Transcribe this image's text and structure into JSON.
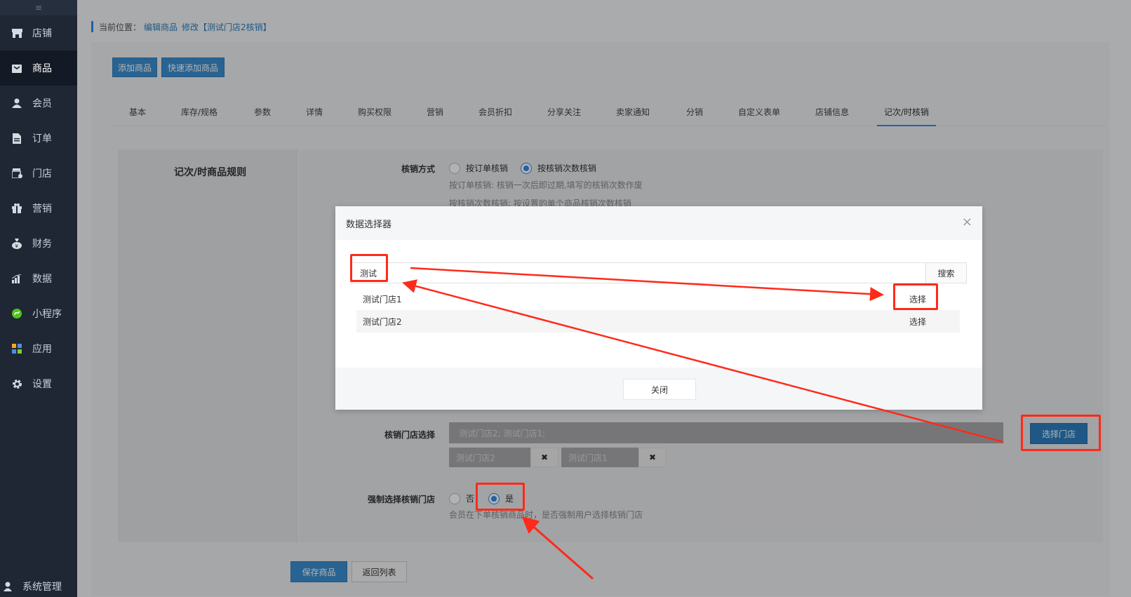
{
  "sidebar": {
    "collapse_icon": "≡",
    "items": [
      {
        "label": "店铺",
        "icon": "store-icon"
      },
      {
        "label": "商品",
        "icon": "goods-icon"
      },
      {
        "label": "会员",
        "icon": "user-icon"
      },
      {
        "label": "订单",
        "icon": "document-icon"
      },
      {
        "label": "门店",
        "icon": "shop-icon"
      },
      {
        "label": "营销",
        "icon": "gift-icon"
      },
      {
        "label": "财务",
        "icon": "money-icon"
      },
      {
        "label": "数据",
        "icon": "chart-icon"
      },
      {
        "label": "小程序",
        "icon": "miniapp-icon"
      },
      {
        "label": "应用",
        "icon": "apps-icon"
      },
      {
        "label": "设置",
        "icon": "gear-icon"
      }
    ],
    "bottom_label": "系统管理"
  },
  "breadcrumb": {
    "prefix": "当前位置：",
    "link1": "编辑商品",
    "link2": "修改【测试门店2核销】"
  },
  "toolbar": {
    "add_goods": "添加商品",
    "quick_add_goods": "快速添加商品"
  },
  "tabs": [
    "基本",
    "库存/规格",
    "参数",
    "详情",
    "购买权限",
    "营销",
    "会员折扣",
    "分享关注",
    "卖家通知",
    "分销",
    "自定义表单",
    "店铺信息",
    "记次/时核销"
  ],
  "form": {
    "section_title": "记次/时商品规则",
    "verify_method_label": "核销方式",
    "verify_option1": "按订单核销",
    "verify_option2": "按核销次数核销",
    "verify_hint1": "按订单核销: 核销一次后即过期,填写的核销次数作废",
    "verify_hint2": "按核销次数核销: 按设置的单个商品核销次数核销",
    "store_select_label": "核销门店选择",
    "store_select_value": "测试门店2; 测试门店1;",
    "select_store_button": "选择门店",
    "tag1": "测试门店2",
    "tag2": "测试门店1",
    "tag_remove": "✖",
    "force_label": "强制选择核销门店",
    "force_no": "否",
    "force_yes": "是",
    "force_hint": "会员在下单核销商品时，是否强制用户选择核销门店",
    "save_button": "保存商品",
    "back_button": "返回列表"
  },
  "modal": {
    "title": "数据选择器",
    "close_icon": "×",
    "search_value": "测试",
    "search_button": "搜索",
    "results": [
      {
        "name": "测试门店1",
        "action": "选择"
      },
      {
        "name": "测试门店2",
        "action": "选择"
      }
    ],
    "close_button": "关闭"
  },
  "colors": {
    "accent": "#2d8cf0",
    "primary_button": "#3b8fd1",
    "sidebar_bg": "#1f2735",
    "annotation_red": "#ff2a1a"
  }
}
